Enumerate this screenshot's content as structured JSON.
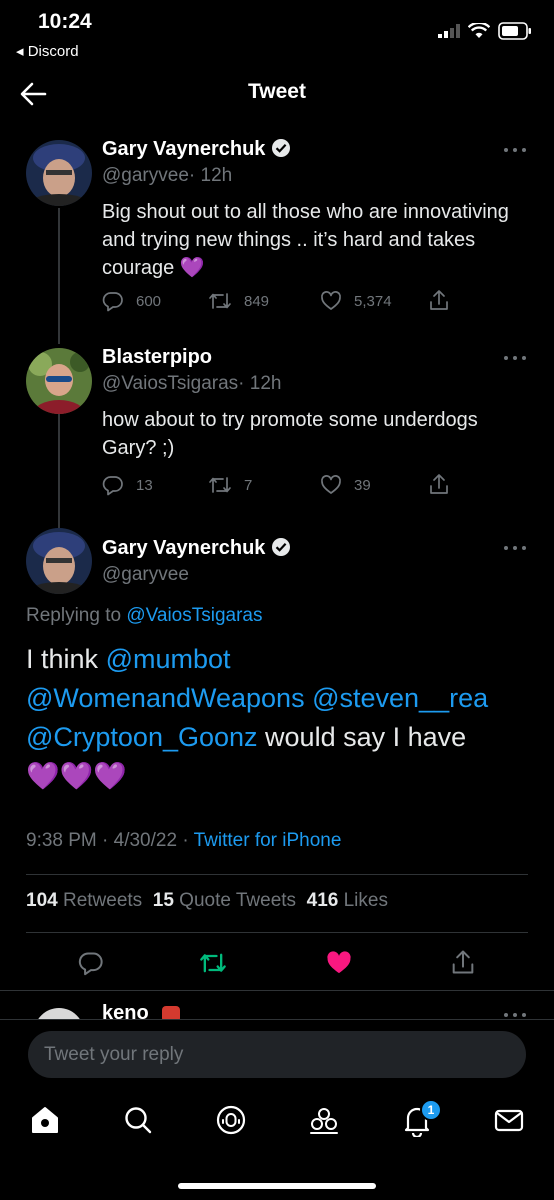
{
  "status": {
    "time": "10:24",
    "back_app": "Discord"
  },
  "header": {
    "title": "Tweet"
  },
  "tweet1": {
    "name": "Gary Vaynerchuk",
    "handle": "@garyvee",
    "time": "· 12h",
    "text": "Big shout out to all those who are innovativing and trying new things .. it’s hard and takes courage 💜",
    "replies": "600",
    "retweets": "849",
    "likes": "5,374"
  },
  "tweet2": {
    "name": "Blasterpipo",
    "handle": "@VaiosTsigaras",
    "time": "· 12h",
    "text": "how about to try promote some underdogs Gary? ;)",
    "replies": "13",
    "retweets": "7",
    "likes": "39"
  },
  "main_tweet": {
    "name": "Gary Vaynerchuk",
    "handle": "@garyvee",
    "replying_prefix": "Replying to",
    "replying_to": "@VaiosTsigaras",
    "text_prefix": "I think",
    "mention1": "@mumbot",
    "mention2": "@WomenandWeapons",
    "mention3": "@steven__rea",
    "mention4": "@Cryptoon_Goonz",
    "text_suffix": "would say I have",
    "hearts": "💜💜💜",
    "timestamp": "9:38 PM · 4/30/22 ·",
    "source": "Twitter for iPhone",
    "retweets_count": "104",
    "retweets_label": "Retweets",
    "quotes_count": "15",
    "quotes_label": "Quote Tweets",
    "likes_count": "416",
    "likes_label": "Likes"
  },
  "next_reply": {
    "name": "keno"
  },
  "reply": {
    "placeholder": "Tweet your reply"
  },
  "nav": {
    "notification_badge": "1"
  },
  "colors": {
    "accent": "#1d9bf0",
    "retweet": "#00ba7c",
    "like": "#f91880",
    "background": "#000000"
  },
  "icons": [
    "back-arrow-icon",
    "verified-icon",
    "more-icon",
    "reply-icon",
    "retweet-icon",
    "like-icon",
    "share-icon",
    "home-icon",
    "search-icon",
    "spaces-icon",
    "communities-icon",
    "notifications-icon",
    "messages-icon"
  ]
}
